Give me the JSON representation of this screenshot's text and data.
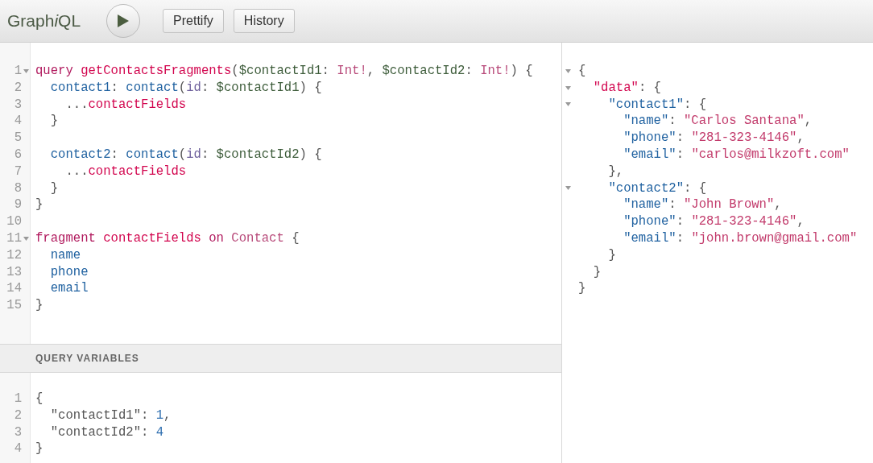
{
  "toolbar": {
    "logo": [
      {
        "text": "Graph",
        "italic": false
      },
      {
        "text": "i",
        "italic": true
      },
      {
        "text": "QL",
        "italic": false
      }
    ],
    "buttons": [
      "Prettify",
      "History"
    ]
  },
  "query_editor": {
    "lines": [
      {
        "number": "1",
        "fold": true,
        "tokens": [
          {
            "text": "query ",
            "kind": "kw"
          },
          {
            "text": "getContactsFragments",
            "kind": "def"
          },
          {
            "text": "(",
            "kind": "p"
          },
          {
            "text": "$contactId1",
            "kind": "var"
          },
          {
            "text": ": ",
            "kind": "p"
          },
          {
            "text": "Int!",
            "kind": "type"
          },
          {
            "text": ", ",
            "kind": "p"
          },
          {
            "text": "$contactId2",
            "kind": "var"
          },
          {
            "text": ": ",
            "kind": "p"
          },
          {
            "text": "Int!",
            "kind": "type"
          },
          {
            "text": ") {",
            "kind": "p"
          }
        ]
      },
      {
        "number": "2",
        "fold": false,
        "tokens": [
          {
            "text": "  contact1",
            "kind": "prop"
          },
          {
            "text": ": ",
            "kind": "p"
          },
          {
            "text": "contact",
            "kind": "prop"
          },
          {
            "text": "(",
            "kind": "p"
          },
          {
            "text": "id",
            "kind": "attr"
          },
          {
            "text": ": ",
            "kind": "p"
          },
          {
            "text": "$contactId1",
            "kind": "var"
          },
          {
            "text": ") {",
            "kind": "p"
          }
        ]
      },
      {
        "number": "3",
        "fold": false,
        "tokens": [
          {
            "text": "    ...",
            "kind": "p"
          },
          {
            "text": "contactFields",
            "kind": "def"
          }
        ]
      },
      {
        "number": "4",
        "fold": false,
        "tokens": [
          {
            "text": "  }",
            "kind": "p"
          }
        ]
      },
      {
        "number": "5",
        "fold": false
      },
      {
        "number": "6",
        "fold": false,
        "tokens": [
          {
            "text": "  contact2",
            "kind": "prop"
          },
          {
            "text": ": ",
            "kind": "p"
          },
          {
            "text": "contact",
            "kind": "prop"
          },
          {
            "text": "(",
            "kind": "p"
          },
          {
            "text": "id",
            "kind": "attr"
          },
          {
            "text": ": ",
            "kind": "p"
          },
          {
            "text": "$contactId2",
            "kind": "var"
          },
          {
            "text": ") {",
            "kind": "p"
          }
        ]
      },
      {
        "number": "7",
        "fold": false,
        "tokens": [
          {
            "text": "    ...",
            "kind": "p"
          },
          {
            "text": "contactFields",
            "kind": "def"
          }
        ]
      },
      {
        "number": "8",
        "fold": false,
        "tokens": [
          {
            "text": "  }",
            "kind": "p"
          }
        ]
      },
      {
        "number": "9",
        "fold": false,
        "tokens": [
          {
            "text": "}",
            "kind": "p"
          }
        ]
      },
      {
        "number": "10",
        "fold": false
      },
      {
        "number": "11",
        "fold": true,
        "tokens": [
          {
            "text": "fragment ",
            "kind": "kw"
          },
          {
            "text": "contactFields",
            "kind": "def"
          },
          {
            "text": " on ",
            "kind": "kw"
          },
          {
            "text": "Contact",
            "kind": "type"
          },
          {
            "text": " {",
            "kind": "p"
          }
        ]
      },
      {
        "number": "12",
        "fold": false,
        "tokens": [
          {
            "text": "  name",
            "kind": "prop"
          }
        ]
      },
      {
        "number": "13",
        "fold": false,
        "tokens": [
          {
            "text": "  phone",
            "kind": "prop"
          }
        ]
      },
      {
        "number": "14",
        "fold": false,
        "tokens": [
          {
            "text": "  email",
            "kind": "prop"
          }
        ]
      },
      {
        "number": "15",
        "fold": false,
        "tokens": [
          {
            "text": "}",
            "kind": "p"
          }
        ]
      }
    ]
  },
  "variables_editor": {
    "title": "QUERY VARIABLES",
    "lines": [
      {
        "number": "1",
        "tokens": [
          {
            "text": "{",
            "kind": "p"
          }
        ]
      },
      {
        "number": "2",
        "tokens": [
          {
            "text": "  \"contactId1\": ",
            "kind": "p"
          },
          {
            "text": "1",
            "kind": "num"
          },
          {
            "text": ",",
            "kind": "p"
          }
        ]
      },
      {
        "number": "3",
        "tokens": [
          {
            "text": "  \"contactId2\": ",
            "kind": "p"
          },
          {
            "text": "4",
            "kind": "num"
          }
        ]
      },
      {
        "number": "4",
        "tokens": [
          {
            "text": "}",
            "kind": "p"
          }
        ]
      }
    ]
  },
  "result_viewer": {
    "lines": [
      {
        "fold": true,
        "tokens": [
          {
            "text": "{",
            "kind": "p"
          }
        ]
      },
      {
        "fold": true,
        "tokens": [
          {
            "text": "  \"data\"",
            "kind": "def"
          },
          {
            "text": ": {",
            "kind": "p"
          }
        ]
      },
      {
        "fold": true,
        "tokens": [
          {
            "text": "    \"contact1\"",
            "kind": "prop"
          },
          {
            "text": ": {",
            "kind": "p"
          }
        ]
      },
      {
        "fold": false,
        "tokens": [
          {
            "text": "      \"name\"",
            "kind": "prop"
          },
          {
            "text": ": ",
            "kind": "p"
          },
          {
            "text": "\"Carlos Santana\"",
            "kind": "str"
          },
          {
            "text": ",",
            "kind": "p"
          }
        ]
      },
      {
        "fold": false,
        "tokens": [
          {
            "text": "      \"phone\"",
            "kind": "prop"
          },
          {
            "text": ": ",
            "kind": "p"
          },
          {
            "text": "\"281-323-4146\"",
            "kind": "str"
          },
          {
            "text": ",",
            "kind": "p"
          }
        ]
      },
      {
        "fold": false,
        "tokens": [
          {
            "text": "      \"email\"",
            "kind": "prop"
          },
          {
            "text": ": ",
            "kind": "p"
          },
          {
            "text": "\"carlos@milkzoft.com\"",
            "kind": "str"
          }
        ]
      },
      {
        "fold": false,
        "tokens": [
          {
            "text": "    },",
            "kind": "p"
          }
        ]
      },
      {
        "fold": true,
        "tokens": [
          {
            "text": "    \"contact2\"",
            "kind": "prop"
          },
          {
            "text": ": {",
            "kind": "p"
          }
        ]
      },
      {
        "fold": false,
        "tokens": [
          {
            "text": "      \"name\"",
            "kind": "prop"
          },
          {
            "text": ": ",
            "kind": "p"
          },
          {
            "text": "\"John Brown\"",
            "kind": "str"
          },
          {
            "text": ",",
            "kind": "p"
          }
        ]
      },
      {
        "fold": false,
        "tokens": [
          {
            "text": "      \"phone\"",
            "kind": "prop"
          },
          {
            "text": ": ",
            "kind": "p"
          },
          {
            "text": "\"281-323-4146\"",
            "kind": "str"
          },
          {
            "text": ",",
            "kind": "p"
          }
        ]
      },
      {
        "fold": false,
        "tokens": [
          {
            "text": "      \"email\"",
            "kind": "prop"
          },
          {
            "text": ": ",
            "kind": "p"
          },
          {
            "text": "\"john.brown@gmail.com\"",
            "kind": "str"
          }
        ]
      },
      {
        "fold": false,
        "tokens": [
          {
            "text": "    }",
            "kind": "p"
          }
        ]
      },
      {
        "fold": false,
        "tokens": [
          {
            "text": "  }",
            "kind": "p"
          }
        ]
      },
      {
        "fold": false,
        "tokens": [
          {
            "text": "}",
            "kind": "p"
          }
        ]
      }
    ]
  }
}
